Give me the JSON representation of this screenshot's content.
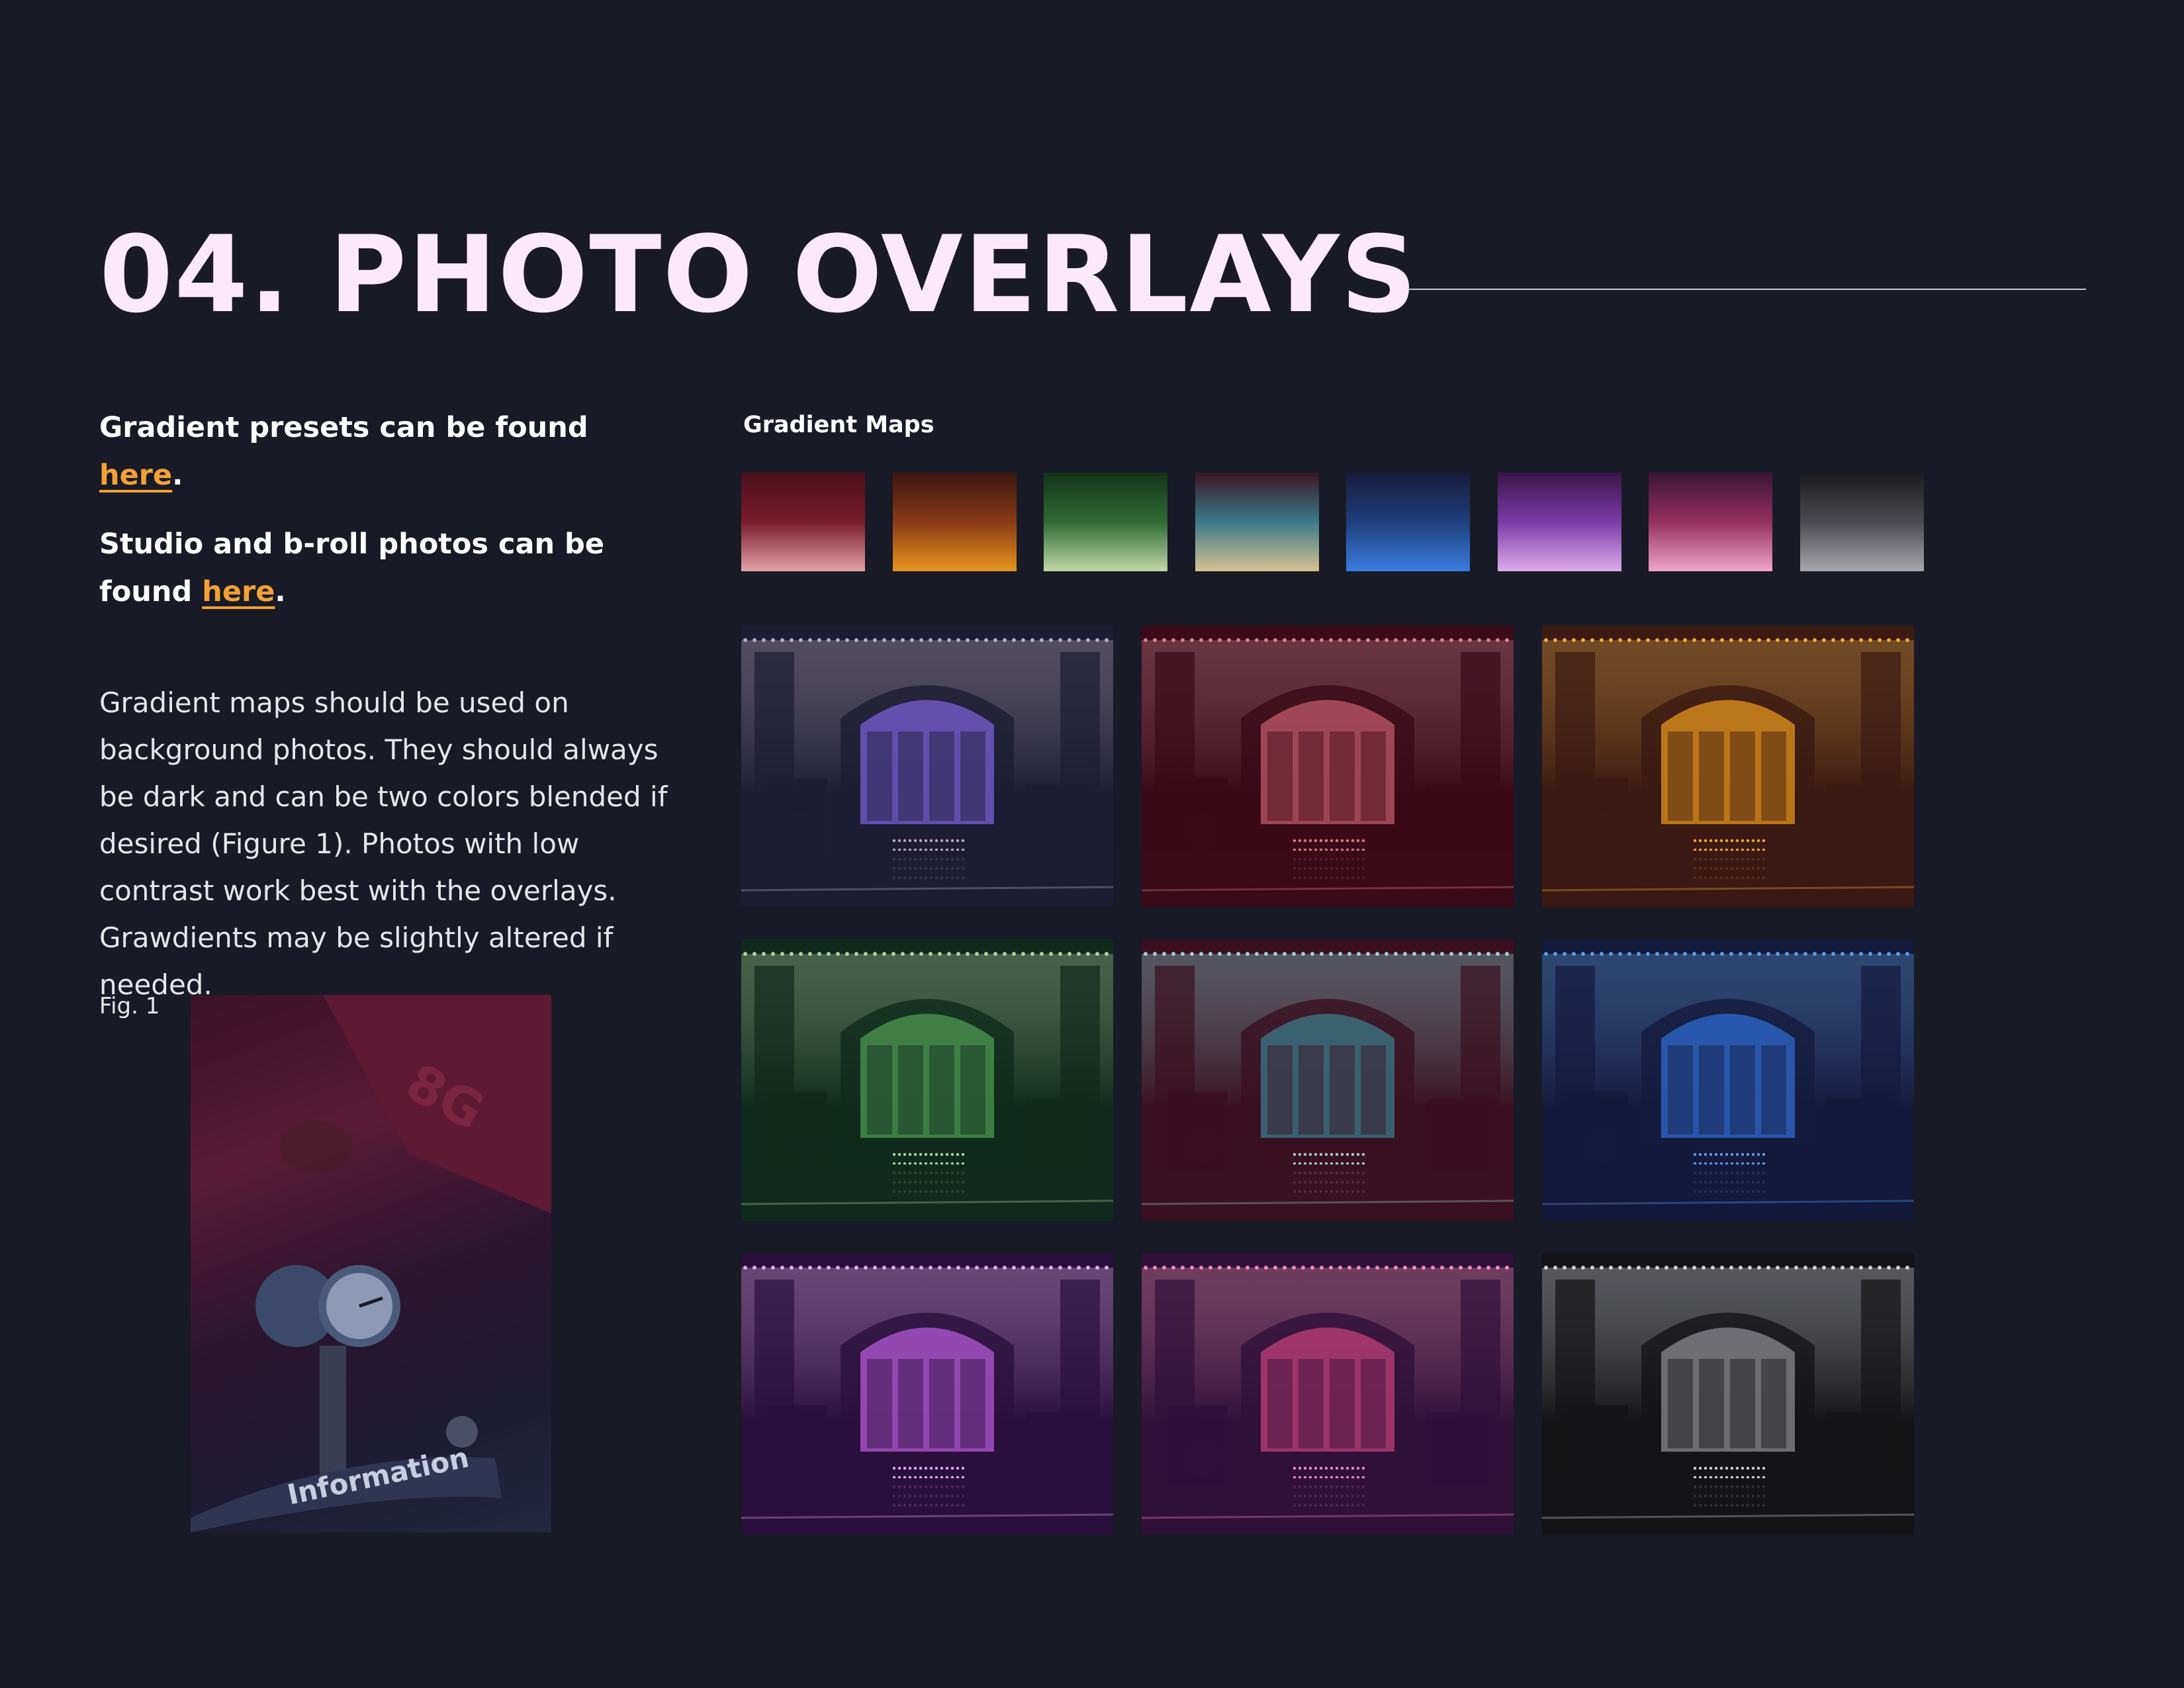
{
  "header": {
    "title": "04. PHOTO OVERLAYS"
  },
  "intro": {
    "presets_prefix": "Gradient presets can be found ",
    "presets_link": "here",
    "presets_suffix": ".",
    "photos_prefix": "Studio and b-roll photos can be found ",
    "photos_link": "here",
    "photos_suffix": "."
  },
  "body": {
    "text": "Gradient maps should be used on background photos. They should always be dark and can be two colors blended if desired (Figure 1). Photos with low contrast work best with the overlays. Grawdients may be slightly altered if needed."
  },
  "figure": {
    "caption": "Fig. 1",
    "sign_number": "8G",
    "sign_text": "Information",
    "colors": [
      "#3a1227",
      "#5a1a35",
      "#1d1a33"
    ]
  },
  "gradient_maps": {
    "label": "Gradient Maps",
    "swatches": [
      {
        "name": "red",
        "top": "#4a0f1c",
        "mid": "#7a1c2a",
        "bottom": "#e3a2a6"
      },
      {
        "name": "orange",
        "top": "#3a1712",
        "mid": "#8a3a16",
        "bottom": "#e6941e"
      },
      {
        "name": "green",
        "top": "#143319",
        "mid": "#2f6b35",
        "bottom": "#c0d7a9"
      },
      {
        "name": "teal",
        "top": "#3b1722",
        "mid": "#3b7a8a",
        "bottom": "#d8c193"
      },
      {
        "name": "blue",
        "top": "#171b3a",
        "mid": "#1f3f7d",
        "bottom": "#3a7de0"
      },
      {
        "name": "purple",
        "top": "#3a1547",
        "mid": "#7b3ba8",
        "bottom": "#ddacea"
      },
      {
        "name": "magenta",
        "top": "#3a1537",
        "mid": "#95305e",
        "bottom": "#f1a5c8"
      },
      {
        "name": "gray",
        "top": "#1b1b1f",
        "mid": "#4a4a50",
        "bottom": "#a8a8ae"
      }
    ]
  },
  "photos": [
    {
      "name": "original",
      "dark": "#1c1d33",
      "light": "#b9a7c3",
      "glow": "#7a5fd6"
    },
    {
      "name": "red",
      "dark": "#3a0a18",
      "light": "#d97a86",
      "glow": "#c05a6a"
    },
    {
      "name": "orange",
      "dark": "#3a1a12",
      "light": "#f0a53a",
      "glow": "#e6941e"
    },
    {
      "name": "green",
      "dark": "#0f2a1c",
      "light": "#a9d49b",
      "glow": "#4d9a52"
    },
    {
      "name": "teal",
      "dark": "#3a1020",
      "light": "#9fcfd4",
      "glow": "#3b7a8a"
    },
    {
      "name": "blue",
      "dark": "#141a3c",
      "light": "#5a9be8",
      "glow": "#2f6bd0"
    },
    {
      "name": "purple",
      "dark": "#2a0f3c",
      "light": "#e7a6f0",
      "glow": "#b45ad6"
    },
    {
      "name": "magenta",
      "dark": "#30103a",
      "light": "#f08ab8",
      "glow": "#c2407a"
    },
    {
      "name": "gray",
      "dark": "#141416",
      "light": "#d0d0d4",
      "glow": "#8a8a90"
    }
  ]
}
